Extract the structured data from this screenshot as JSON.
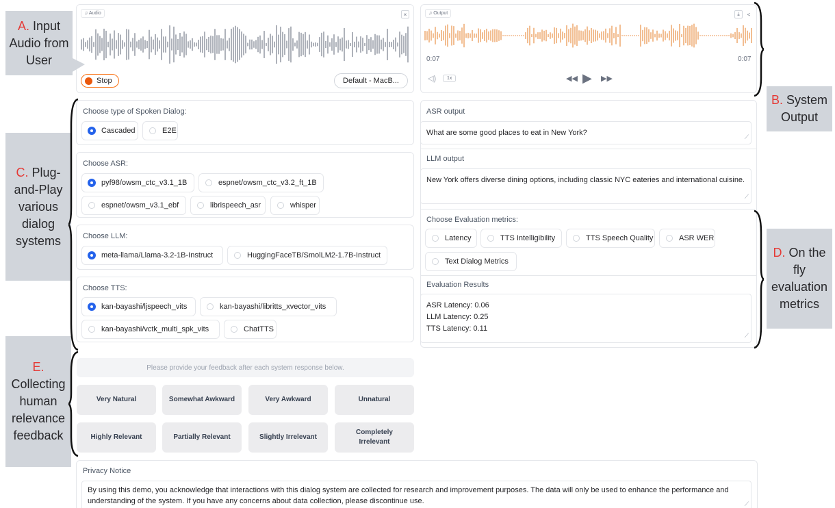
{
  "input_panel": {
    "tag": "Audio",
    "close_icon": "×",
    "stop_label": "Stop",
    "device_label": "Default - MacB..."
  },
  "output_panel": {
    "tag": "Output",
    "time_start": "0:07",
    "time_end": "0:07",
    "speed": "1x",
    "download_icon": "⤓",
    "share_icon": "<",
    "wave_color": "#e8883a"
  },
  "dialog_type": {
    "label": "Choose type of Spoken Dialog:",
    "options": [
      "Cascaded",
      "E2E"
    ],
    "selected": "Cascaded"
  },
  "asr": {
    "label": "Choose ASR:",
    "options": [
      "pyf98/owsm_ctc_v3.1_1B",
      "espnet/owsm_ctc_v3.2_ft_1B",
      "espnet/owsm_v3.1_ebf",
      "librispeech_asr",
      "whisper"
    ],
    "selected": "pyf98/owsm_ctc_v3.1_1B"
  },
  "llm": {
    "label": "Choose LLM:",
    "options": [
      "meta-llama/Llama-3.2-1B-Instruct",
      "HuggingFaceTB/SmolLM2-1.7B-Instruct"
    ],
    "selected": "meta-llama/Llama-3.2-1B-Instruct"
  },
  "tts": {
    "label": "Choose TTS:",
    "options": [
      "kan-bayashi/ljspeech_vits",
      "kan-bayashi/libritts_xvector_vits",
      "kan-bayashi/vctk_multi_spk_vits",
      "ChatTTS"
    ],
    "selected": "kan-bayashi/ljspeech_vits"
  },
  "asr_output": {
    "label": "ASR output",
    "value": "What are some good places to eat in New York?"
  },
  "llm_output": {
    "label": "LLM output",
    "value": "New York offers diverse dining options, including classic NYC eateries and international cuisine."
  },
  "metrics": {
    "label": "Choose Evaluation metrics:",
    "options": [
      "Latency",
      "TTS Intelligibility",
      "TTS Speech Quality",
      "ASR WER",
      "Text Dialog Metrics"
    ]
  },
  "results": {
    "label": "Evaluation Results",
    "lines": [
      "ASR Latency: 0.06",
      "LLM Latency: 0.25",
      "TTS Latency: 0.11"
    ]
  },
  "feedback": {
    "note": "Please provide your feedback after each system response below.",
    "row1": [
      "Very Natural",
      "Somewhat Awkward",
      "Very Awkward",
      "Unnatural"
    ],
    "row2": [
      "Highly Relevant",
      "Partially Relevant",
      "Slightly Irrelevant",
      "Completely Irrelevant"
    ]
  },
  "privacy": {
    "label": "Privacy Notice",
    "text": "By using this demo, you acknowledge that interactions with this dialog system are collected for research and improvement purposes. The data will only be used to enhance the performance and understanding of the system. If you have any concerns about data collection, please discontinue use."
  },
  "annotations": {
    "a": {
      "letter": "A.",
      "text": "Input Audio from User"
    },
    "b": {
      "letter": "B.",
      "text": "System Output"
    },
    "c": {
      "letter": "C.",
      "text": "Plug-and-Play various dialog systems"
    },
    "d": {
      "letter": "D.",
      "text": "On the fly evaluation metrics"
    },
    "e": {
      "letter": "E.",
      "text": "Collecting human relevance feedback"
    }
  }
}
